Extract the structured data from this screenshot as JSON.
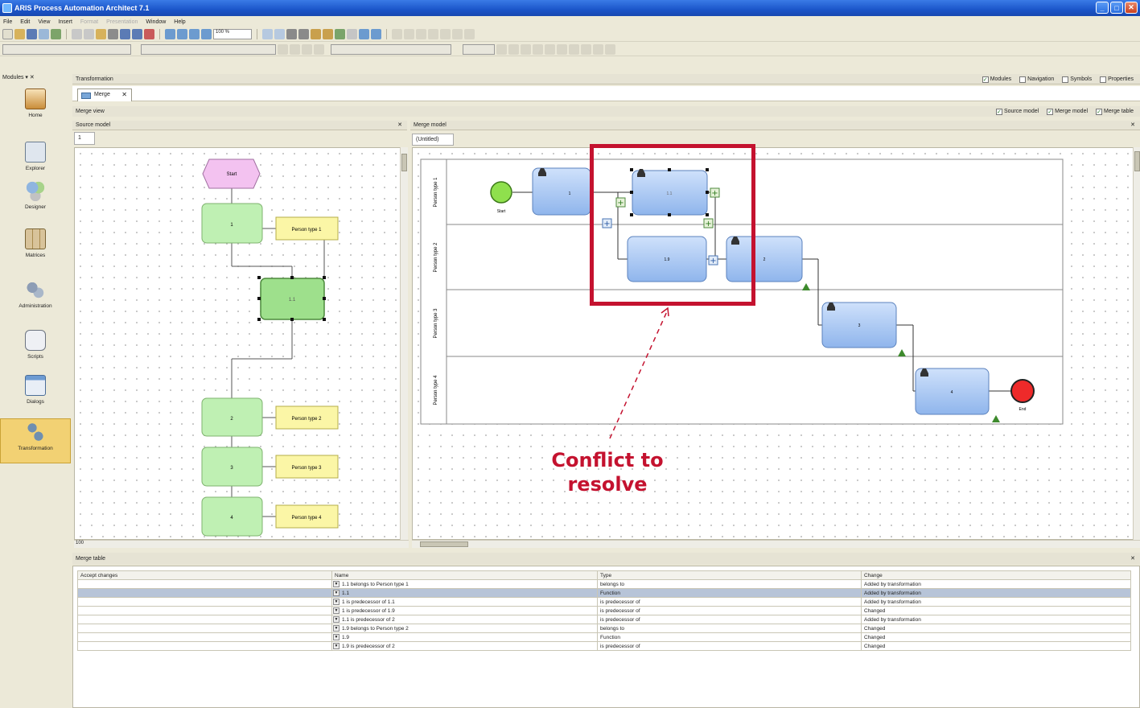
{
  "window": {
    "title": "ARIS Process Automation Architect 7.1",
    "controls": [
      "_",
      "□",
      "✕"
    ]
  },
  "menu": [
    "File",
    "Edit",
    "View",
    "Insert",
    "Format",
    "Presentation",
    "Window",
    "Help"
  ],
  "toolbar": {
    "zoom": "100 %"
  },
  "modules_panel": {
    "title": "Modules",
    "items": [
      {
        "label": "Home",
        "icon": "home-icon"
      },
      {
        "label": "Explorer",
        "icon": "explorer-icon"
      },
      {
        "label": "Designer",
        "icon": "designer-icon"
      },
      {
        "label": "Matrices",
        "icon": "matrices-icon"
      },
      {
        "label": "Administration",
        "icon": "administration-icon"
      },
      {
        "label": "Scripts",
        "icon": "scripts-icon"
      },
      {
        "label": "Dialogs",
        "icon": "dialogs-icon"
      },
      {
        "label": "Transformation",
        "icon": "transformation-icon"
      }
    ]
  },
  "transformation": {
    "title": "Transformation",
    "view_toggles": [
      "Modules",
      "Navigation",
      "Symbols",
      "Properties"
    ],
    "tab": "Merge",
    "merge_view_title": "Merge view",
    "merge_toggles": [
      "Source model",
      "Merge model",
      "Merge table"
    ]
  },
  "source_model": {
    "title": "Source model",
    "tab": "1",
    "start": "Start",
    "functions": [
      "1",
      "1.1",
      "2",
      "3",
      "4"
    ],
    "roles": [
      "Person type 1",
      "Person type 2",
      "Person type 3",
      "Person type 4"
    ],
    "zoom": "100"
  },
  "merge_model": {
    "title": "Merge model",
    "tab": "(Untitled)",
    "lanes": [
      "Person type 1",
      "Person type 2",
      "Person type 3",
      "Person type 4"
    ],
    "start": "Start",
    "end": "End",
    "tasks": [
      "1",
      "1.1",
      "1.9",
      "2",
      "3",
      "4"
    ]
  },
  "merge_table": {
    "title": "Merge table",
    "columns": [
      "Accept changes",
      "Name",
      "Type",
      "Change"
    ],
    "rows": [
      {
        "name": "1.1 belongs to Person type 1",
        "type": "belongs to",
        "change": "Added by transformation",
        "selected": false
      },
      {
        "name": "1.1",
        "type": "Function",
        "change": "Added by transformation",
        "selected": true
      },
      {
        "name": "1 is predecessor of 1.1",
        "type": "is predecessor of",
        "change": "Added by transformation",
        "selected": false
      },
      {
        "name": "1 is predecessor of 1.9",
        "type": "is predecessor of",
        "change": "Changed",
        "selected": false
      },
      {
        "name": "1.1 is predecessor of 2",
        "type": "is predecessor of",
        "change": "Added by transformation",
        "selected": false
      },
      {
        "name": "1.9 belongs to Person type 2",
        "type": "belongs to",
        "change": "Changed",
        "selected": false
      },
      {
        "name": "1.9",
        "type": "Function",
        "change": "Changed",
        "selected": false
      },
      {
        "name": "1.9 is predecessor of 2",
        "type": "is predecessor of",
        "change": "Changed",
        "selected": false
      }
    ]
  },
  "annotation": {
    "line1": "Conflict to",
    "line2": "resolve",
    "color": "#c4122f"
  }
}
